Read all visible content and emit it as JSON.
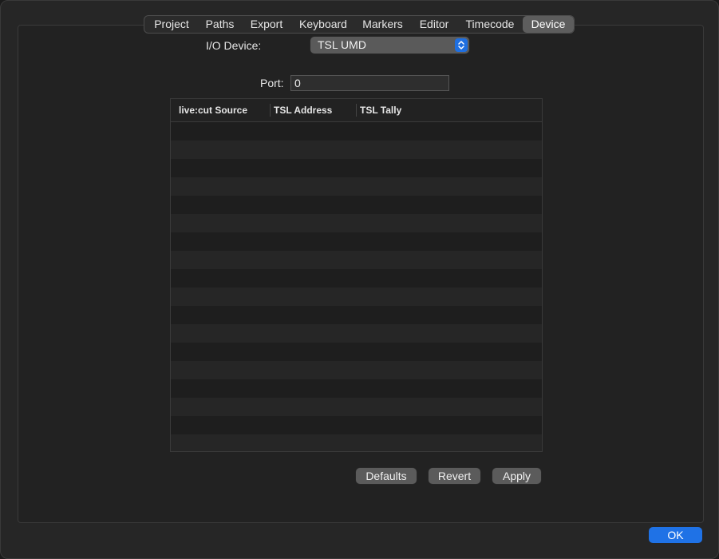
{
  "tabs": [
    {
      "label": "Project",
      "active": false
    },
    {
      "label": "Paths",
      "active": false
    },
    {
      "label": "Export",
      "active": false
    },
    {
      "label": "Keyboard",
      "active": false
    },
    {
      "label": "Markers",
      "active": false
    },
    {
      "label": "Editor",
      "active": false
    },
    {
      "label": "Timecode",
      "active": false
    },
    {
      "label": "Device",
      "active": true
    }
  ],
  "device": {
    "io_label": "I/O Device:",
    "io_value": "TSL UMD",
    "port_label": "Port:",
    "port_value": "0"
  },
  "table": {
    "columns": [
      "live:cut Source",
      "TSL Address",
      "TSL Tally"
    ],
    "rows": []
  },
  "buttons": {
    "defaults": "Defaults",
    "revert": "Revert",
    "apply": "Apply",
    "ok": "OK"
  },
  "colors": {
    "accent": "#1f72e6",
    "window_bg": "#262626",
    "panel_bg": "#222222"
  },
  "icons": {
    "popup": "up-down-chevron-icon"
  }
}
